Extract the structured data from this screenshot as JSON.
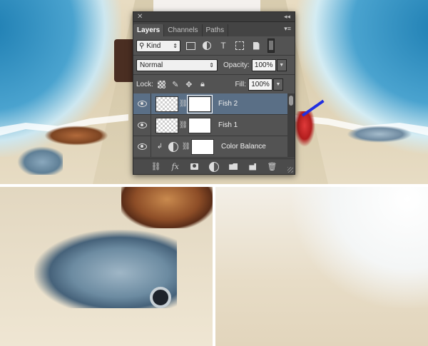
{
  "panel": {
    "tabs": [
      {
        "label": "Layers",
        "active": true
      },
      {
        "label": "Channels",
        "active": false
      },
      {
        "label": "Paths",
        "active": false
      }
    ],
    "filter": {
      "kind_label": "Kind",
      "icons": [
        "pixel-filter-icon",
        "adjustment-filter-icon",
        "type-filter-icon",
        "shape-filter-icon",
        "smart-object-filter-icon"
      ]
    },
    "blend_mode": "Normal",
    "opacity_label": "Opacity:",
    "opacity_value": "100%",
    "lock_label": "Lock:",
    "fill_label": "Fill:",
    "fill_value": "100%",
    "layers": [
      {
        "name": "Fish 2",
        "type": "pixel-with-mask",
        "selected": true,
        "visible": true
      },
      {
        "name": "Fish 1",
        "type": "pixel-with-mask",
        "selected": false,
        "visible": true
      },
      {
        "name": "Color Balance",
        "type": "adjustment-clipped",
        "selected": false,
        "visible": true
      }
    ],
    "bottom_icons": [
      "link-icon",
      "fx-icon",
      "add-mask-icon",
      "new-adjustment-icon",
      "new-group-icon",
      "new-layer-icon",
      "trash-icon"
    ],
    "selection_color": "#5a6f86"
  }
}
